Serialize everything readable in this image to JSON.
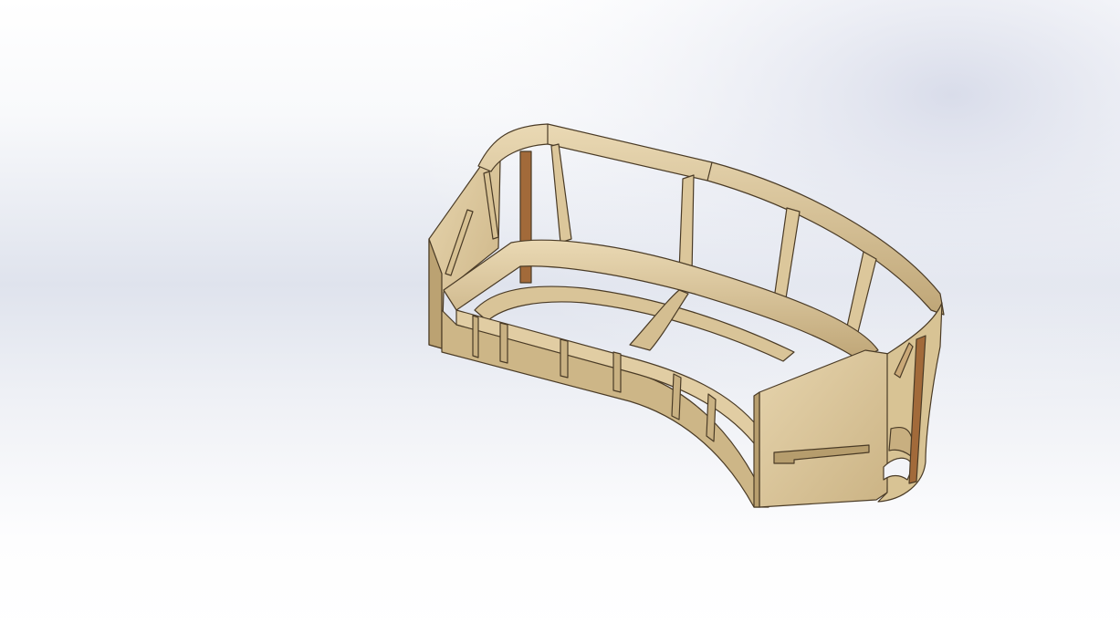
{
  "viewport": {
    "background_top": "#ffffff",
    "background_haze": "#dde1ec",
    "background_bottom": "#ffffff"
  },
  "model": {
    "wood_light": "#e2cfa6",
    "wood_mid": "#cdb687",
    "wood_dark": "#9e8559",
    "edge": "#4a3b26",
    "rod": "#a26a3a"
  }
}
